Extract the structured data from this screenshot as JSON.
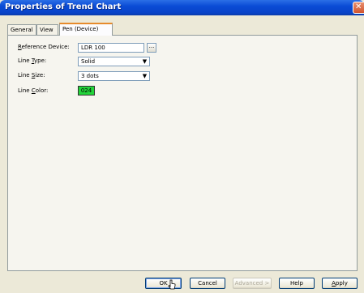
{
  "window": {
    "title": "Properties of Trend Chart",
    "close_glyph": "✕"
  },
  "tabs": [
    {
      "label": "General"
    },
    {
      "label": "View"
    },
    {
      "label": "Pen (Device)",
      "active": true
    }
  ],
  "form": {
    "reference_device": {
      "label_pre": "",
      "label_ul": "R",
      "label_post": "eference Device:",
      "value": "LDR 100",
      "browse_label": "..."
    },
    "line_type": {
      "label_pre": "Line ",
      "label_ul": "T",
      "label_post": "ype:",
      "value": "Solid"
    },
    "line_size": {
      "label_pre": "Line ",
      "label_ul": "S",
      "label_post": "ize:",
      "value": "3 dots"
    },
    "line_color": {
      "label_pre": "Line ",
      "label_ul": "C",
      "label_post": "olor:",
      "value": "024",
      "color": "#22d43a"
    }
  },
  "buttons": {
    "ok": "OK",
    "cancel": "Cancel",
    "advanced": "Advanced >",
    "help": "Help",
    "apply_ul": "A",
    "apply_rest": "pply"
  },
  "icons": {
    "dropdown": "▼"
  }
}
